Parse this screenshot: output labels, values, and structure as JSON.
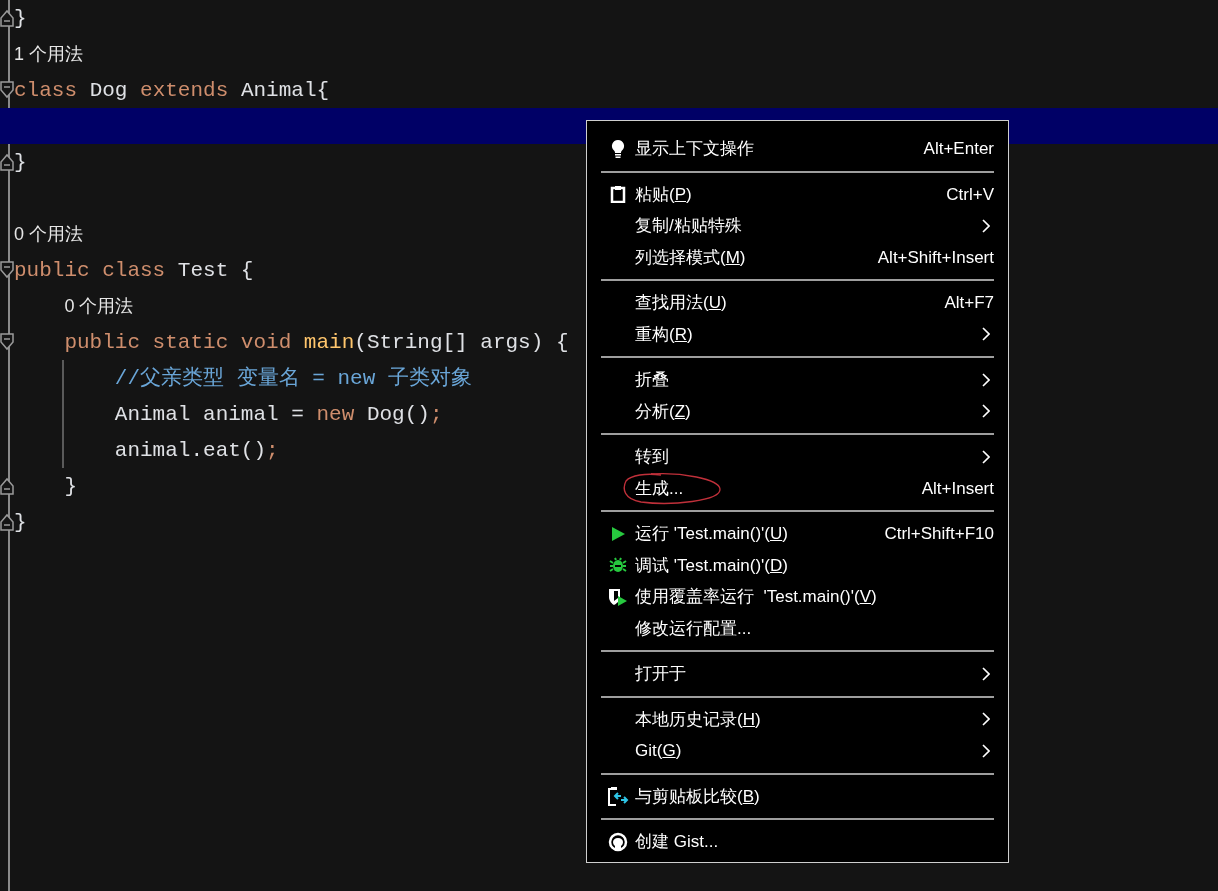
{
  "editor": {
    "lines": [
      {
        "kind": "code",
        "fold_end": true,
        "tokens": [
          {
            "text": "}",
            "kind": "plain"
          }
        ]
      },
      {
        "kind": "hint",
        "text": "1 个用法"
      },
      {
        "kind": "code",
        "fold_start": true,
        "tokens": [
          {
            "text": "class ",
            "kind": "keyword"
          },
          {
            "text": "Dog ",
            "kind": "plain"
          },
          {
            "text": "extends ",
            "kind": "keyword"
          },
          {
            "text": "Animal{",
            "kind": "plain"
          }
        ]
      },
      {
        "kind": "code",
        "current": true
      },
      {
        "kind": "code",
        "fold_end": true,
        "tokens": [
          {
            "text": "}",
            "kind": "plain"
          }
        ]
      },
      {
        "kind": "code"
      },
      {
        "kind": "hint",
        "text": "0 个用法"
      },
      {
        "kind": "code",
        "fold_start": true,
        "tokens": [
          {
            "text": "public class ",
            "kind": "keyword"
          },
          {
            "text": "Test {",
            "kind": "plain"
          }
        ]
      },
      {
        "kind": "hint",
        "text": "0 个用法"
      },
      {
        "kind": "code",
        "fold_start": true,
        "tokens": [
          {
            "text": "    public static void ",
            "kind": "keyword"
          },
          {
            "text": "main",
            "kind": "function"
          },
          {
            "text": "(String[] args) {",
            "kind": "plain"
          }
        ]
      },
      {
        "kind": "code",
        "tokens": [
          {
            "text": "        //父亲类型 变量名 = new 子类对象",
            "kind": "comment"
          }
        ]
      },
      {
        "kind": "code",
        "tokens": [
          {
            "text": "        Animal animal = ",
            "kind": "plain"
          },
          {
            "text": "new ",
            "kind": "keyword"
          },
          {
            "text": "Dog()",
            "kind": "plain"
          },
          {
            "text": ";",
            "kind": "keyword"
          }
        ]
      },
      {
        "kind": "code",
        "tokens": [
          {
            "text": "        animal.eat()",
            "kind": "plain"
          },
          {
            "text": ";",
            "kind": "keyword"
          }
        ]
      },
      {
        "kind": "code",
        "fold_end": true,
        "tokens": [
          {
            "text": "    }",
            "kind": "plain"
          }
        ]
      },
      {
        "kind": "code",
        "fold_end": true,
        "tokens": [
          {
            "text": "}",
            "kind": "plain"
          }
        ]
      }
    ]
  },
  "context_menu": {
    "sections": [
      [
        {
          "kind": "bulb",
          "label": "显示上下文操作",
          "shortcut": "Alt+Enter"
        }
      ],
      [
        {
          "kind": "clipboard",
          "label": "粘贴(",
          "mnemonic": "P",
          "suffix": ")",
          "shortcut": "Ctrl+V"
        },
        {
          "label": "复制/粘贴特殊",
          "submenu": true
        },
        {
          "label": "列选择模式(",
          "mnemonic": "M",
          "suffix": ")",
          "shortcut": "Alt+Shift+Insert"
        }
      ],
      [
        {
          "label": "查找用法(",
          "mnemonic": "U",
          "suffix": ")",
          "shortcut": "Alt+F7"
        },
        {
          "label": "重构(",
          "mnemonic": "R",
          "suffix": ")",
          "submenu": true
        }
      ],
      [
        {
          "label": "折叠",
          "submenu": true
        },
        {
          "label": "分析(",
          "mnemonic": "Z",
          "suffix": ")",
          "submenu": true
        }
      ],
      [
        {
          "label": "转到",
          "submenu": true
        },
        {
          "label": "生成...",
          "shortcut": "Alt+Insert",
          "circled": true
        }
      ],
      [
        {
          "kind": "run",
          "label": "运行 'Test.main()'(",
          "mnemonic": "U",
          "suffix": ")",
          "shortcut": "Ctrl+Shift+F10"
        },
        {
          "kind": "debug",
          "label": "调试 'Test.main()'(",
          "mnemonic": "D",
          "suffix": ")"
        },
        {
          "kind": "coverage",
          "label": "使用覆盖率运行  'Test.main()'(",
          "mnemonic": "V",
          "suffix": ")"
        },
        {
          "label": "修改运行配置..."
        }
      ],
      [
        {
          "label": "打开于",
          "submenu": true
        }
      ],
      [
        {
          "label": "本地历史记录(",
          "mnemonic": "H",
          "suffix": ")",
          "submenu": true
        },
        {
          "label": "Git(",
          "mnemonic": "G",
          "suffix": ")",
          "submenu": true
        }
      ],
      [
        {
          "kind": "compare",
          "label": "与剪贴板比较(",
          "mnemonic": "B",
          "suffix": ")"
        }
      ],
      [
        {
          "kind": "gist",
          "label": "创建 Gist..."
        }
      ]
    ]
  }
}
